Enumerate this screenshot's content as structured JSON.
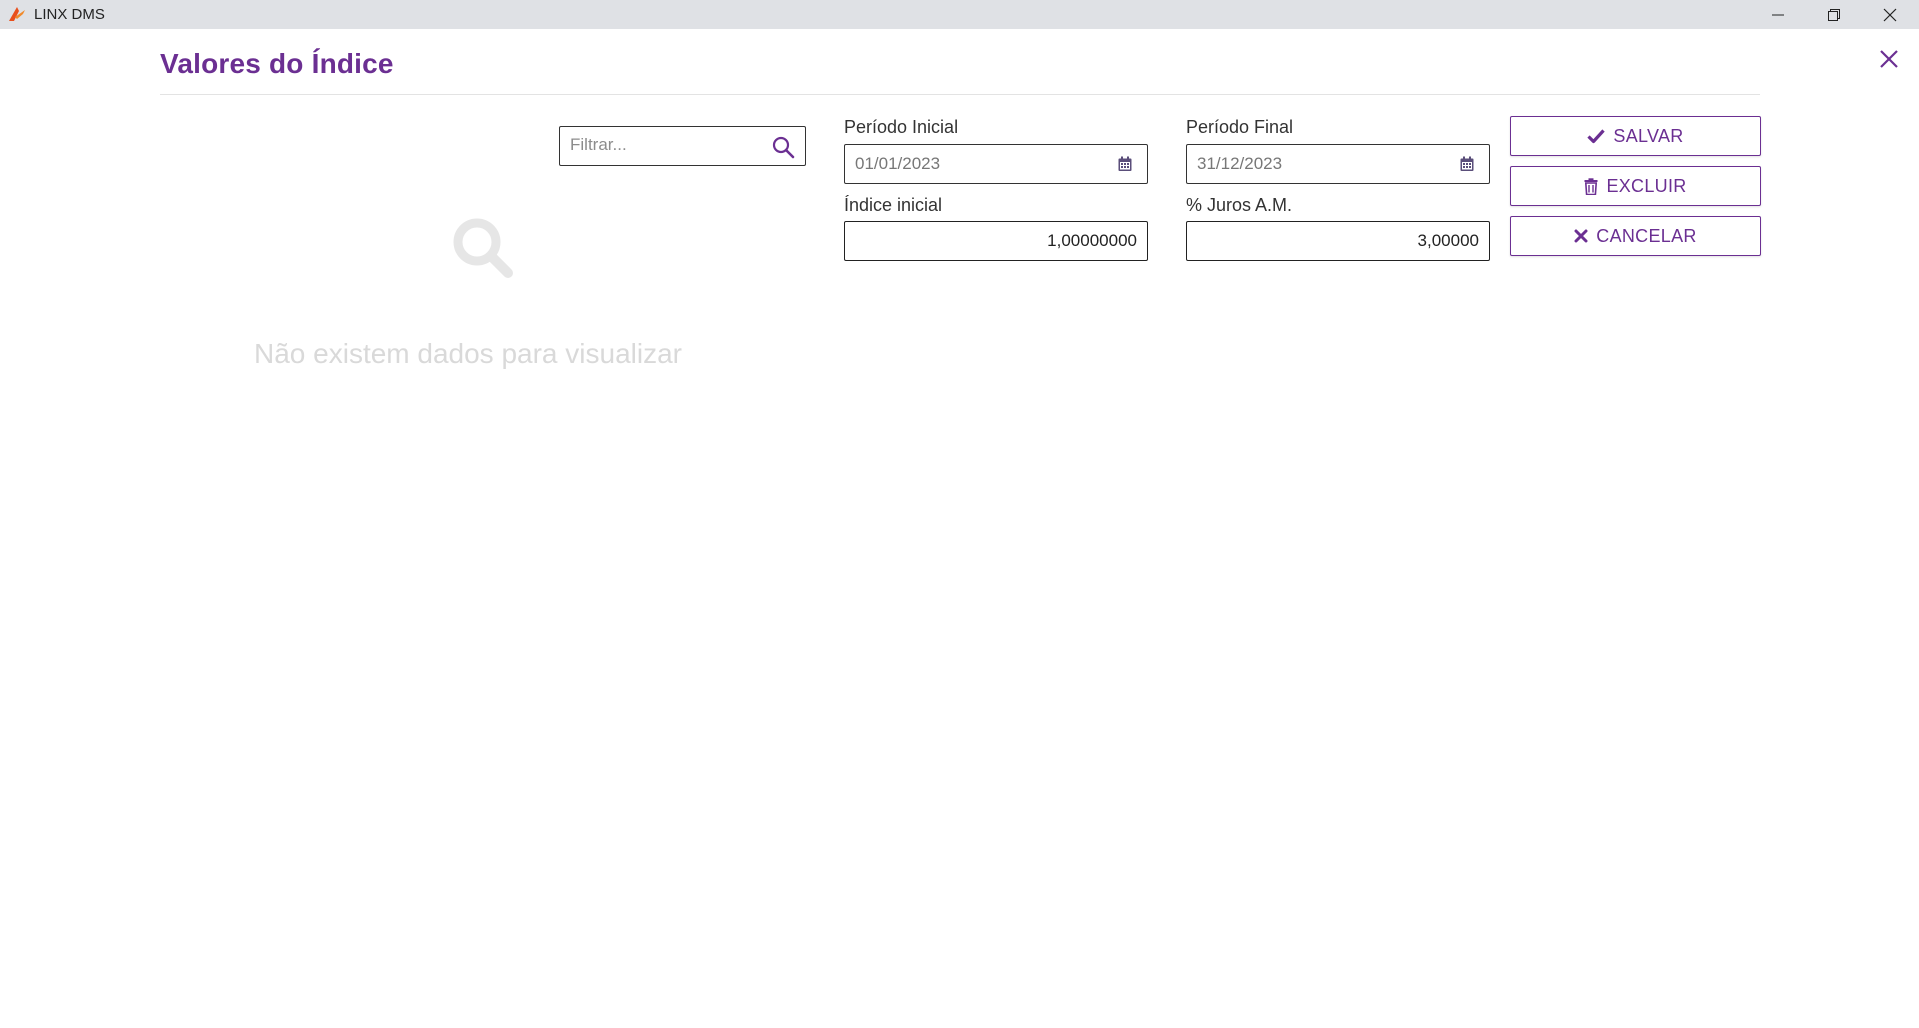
{
  "window": {
    "title": "LINX DMS",
    "accent_color": "#6b2f92"
  },
  "dialog": {
    "title": "Valores do Índice"
  },
  "filter": {
    "placeholder": "Filtrar..."
  },
  "empty_state": {
    "message": "Não existem dados para visualizar"
  },
  "form": {
    "periodo_inicial": {
      "label": "Período Inicial",
      "value": "01/01/2023"
    },
    "periodo_final": {
      "label": "Período Final",
      "value": "31/12/2023"
    },
    "indice_inicial": {
      "label": "Índice inicial",
      "value": "1,00000000"
    },
    "juros": {
      "label": "% Juros A.M.",
      "value": "3,00000"
    }
  },
  "actions": {
    "save_label": "SALVAR",
    "delete_label": "EXCLUIR",
    "cancel_label": "CANCELAR"
  },
  "icons": {
    "app": "linx-logo-icon",
    "search": "search-icon",
    "calendar": "calendar-icon",
    "save": "check-icon",
    "delete": "trash-icon",
    "cancel": "x-icon"
  }
}
